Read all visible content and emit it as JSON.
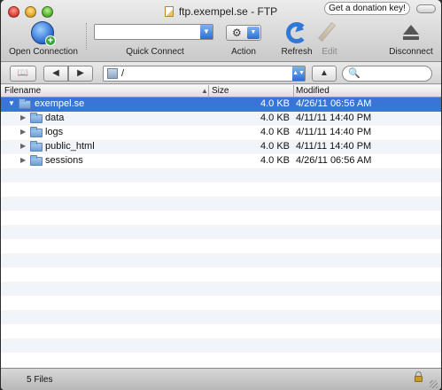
{
  "window": {
    "title": "ftp.exempel.se - FTP",
    "donate_label": "Get a donation key!"
  },
  "toolbar": {
    "open_connection_label": "Open Connection",
    "quick_connect_label": "Quick Connect",
    "quick_connect_value": "",
    "action_label": "Action",
    "refresh_label": "Refresh",
    "edit_label": "Edit",
    "disconnect_label": "Disconnect"
  },
  "navbar": {
    "path": "/",
    "search_placeholder": ""
  },
  "table": {
    "columns": {
      "filename": "Filename",
      "size": "Size",
      "modified": "Modified"
    },
    "rows": [
      {
        "name": "exempel.se",
        "size": "4.0 KB",
        "modified": "4/26/11 06:56 AM",
        "expanded": true,
        "selected": true
      },
      {
        "name": "data",
        "size": "4.0 KB",
        "modified": "4/11/11 14:40 PM"
      },
      {
        "name": "logs",
        "size": "4.0 KB",
        "modified": "4/11/11 14:40 PM"
      },
      {
        "name": "public_html",
        "size": "4.0 KB",
        "modified": "4/11/11 14:40 PM"
      },
      {
        "name": "sessions",
        "size": "4.0 KB",
        "modified": "4/26/11 06:56 AM"
      }
    ]
  },
  "status": {
    "file_count": "5 Files"
  },
  "colors": {
    "selection": "#3875d7",
    "accent": "#2a6fd1"
  }
}
